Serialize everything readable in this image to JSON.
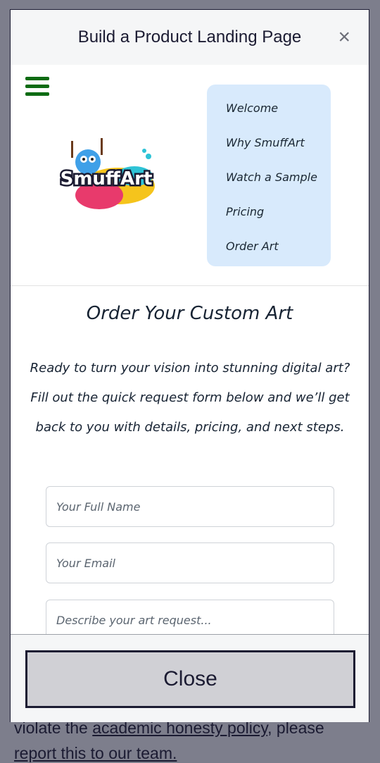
{
  "background": {
    "text_before": "violate the ",
    "link_text": "academic honesty policy",
    "text_after": ", please",
    "line2": "report this to our team."
  },
  "modal": {
    "title": "Build a Product Landing Page",
    "close_x": "×",
    "close_button_label": "Close"
  },
  "preview": {
    "logo_text": "SmuffArt",
    "nav": [
      "Welcome",
      "Why SmuffArt",
      "Watch a Sample",
      "Pricing",
      "Order Art"
    ],
    "section_title": "Order Your Custom Art",
    "intro": "Ready to turn your vision into stunning digital art? Fill out the quick request form below and we’ll get back to you with details, pricing, and next steps.",
    "fields": [
      {
        "placeholder": "Your Full Name"
      },
      {
        "placeholder": "Your Email"
      },
      {
        "placeholder": "Describe your art request..."
      }
    ]
  },
  "colors": {
    "overlay": "#7d7e8c",
    "nav_bg": "#d8eafc",
    "hamburger": "#0d6b13",
    "close_button_bg": "#d0d0d5"
  }
}
